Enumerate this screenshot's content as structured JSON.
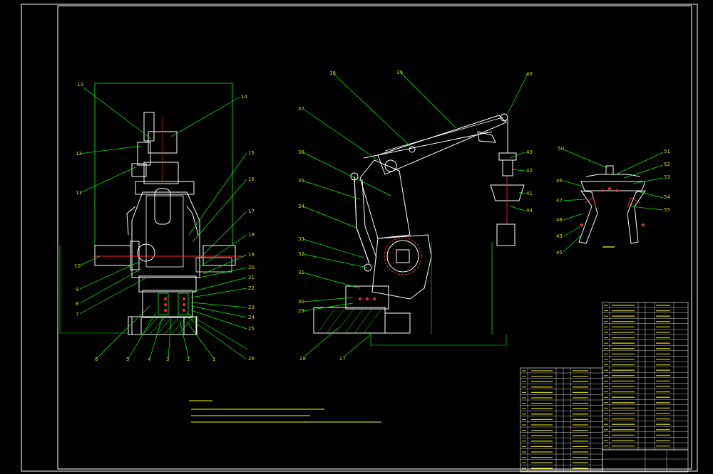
{
  "drawing": {
    "background": "#000000",
    "line_color": "#00ff00",
    "detail_color": "#ffffff",
    "accent_color": "#ff2a2a",
    "label_color": "#d8d800"
  },
  "left_view": {
    "callouts": [
      "13",
      "14",
      "12",
      "11",
      "15",
      "16",
      "17",
      "18",
      "19",
      "20",
      "21",
      "22",
      "23",
      "24",
      "25",
      "26",
      "10",
      "9",
      "8",
      "7",
      "6",
      "5",
      "4",
      "3",
      "2",
      "1"
    ]
  },
  "middle_view": {
    "callouts": [
      "38",
      "39",
      "40",
      "37",
      "36",
      "35",
      "34",
      "33",
      "32",
      "31",
      "30",
      "29",
      "28",
      "27",
      "43",
      "42",
      "41",
      "44"
    ]
  },
  "right_view": {
    "callouts": [
      "50",
      "51",
      "52",
      "53",
      "54",
      "55",
      "46",
      "47",
      "48",
      "49",
      "45"
    ]
  }
}
